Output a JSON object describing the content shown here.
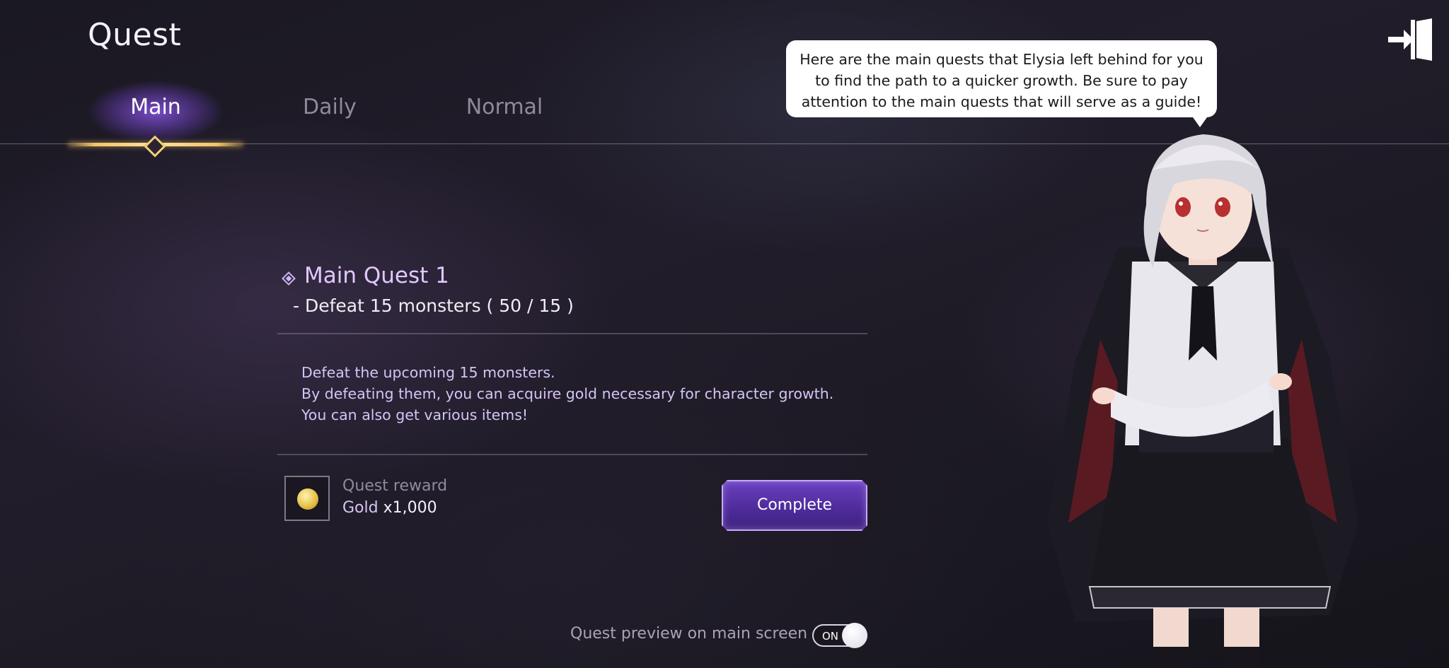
{
  "header": {
    "title": "Quest"
  },
  "tabs": [
    {
      "label": "Main",
      "active": true
    },
    {
      "label": "Daily",
      "active": false
    },
    {
      "label": "Normal",
      "active": false
    }
  ],
  "speech_bubble": {
    "lines": [
      "Here are the main quests that Elysia left behind for you",
      "to find the path to a quicker growth. Be sure to pay",
      "attention to the main quests that will serve as a guide!"
    ]
  },
  "exit_icon": "exit-door-icon",
  "quest": {
    "title": "Main Quest 1",
    "objective": "- Defeat 15 monsters ( 50 / 15 )",
    "description": [
      "Defeat the upcoming 15 monsters.",
      "By defeating them, you can acquire gold necessary for character growth.",
      "You can also get various items!"
    ],
    "reward": {
      "label": "Quest reward",
      "item": "Gold",
      "amount": "x1,000",
      "icon": "gold-coin-icon"
    },
    "complete_label": "Complete"
  },
  "preview_toggle": {
    "label": "Quest preview on main screen",
    "state": "ON"
  },
  "colors": {
    "accent": "#6a40c0",
    "tab_underline": "#f2c46a",
    "quest_title": "#e0c8ff"
  }
}
